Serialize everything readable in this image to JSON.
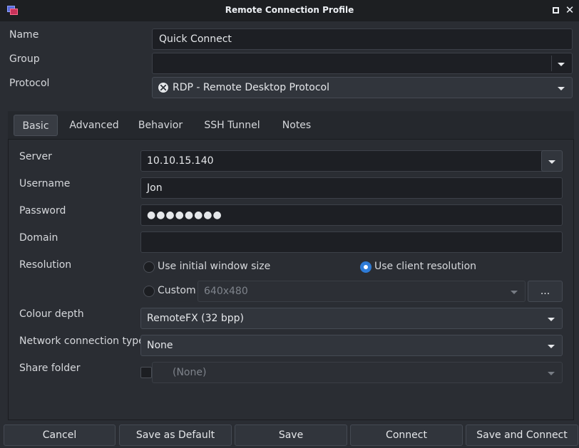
{
  "window": {
    "title": "Remote Connection Profile"
  },
  "profile": {
    "name_label": "Name",
    "name_value": "Quick Connect",
    "group_label": "Group",
    "group_value": "",
    "protocol_label": "Protocol",
    "protocol_value": "RDP - Remote Desktop Protocol",
    "protocol_icon": "rdp-icon"
  },
  "tabs": [
    {
      "label": "Basic",
      "active": true
    },
    {
      "label": "Advanced"
    },
    {
      "label": "Behavior"
    },
    {
      "label": "SSH Tunnel"
    },
    {
      "label": "Notes"
    }
  ],
  "basic": {
    "server_label": "Server",
    "server_value": "10.10.15.140",
    "username_label": "Username",
    "username_value": "Jon",
    "password_label": "Password",
    "password_value": "●●●●●●●●",
    "domain_label": "Domain",
    "domain_value": "",
    "resolution_label": "Resolution",
    "resolution_options": {
      "initial": "Use initial window size",
      "client": "Use client resolution",
      "custom": "Custom"
    },
    "resolution_selected": "client",
    "custom_resolution_value": "640x480",
    "custom_button": "...",
    "colour_depth_label": "Colour depth",
    "colour_depth_value": "RemoteFX (32 bpp)",
    "network_label": "Network connection type",
    "network_value": "None",
    "share_folder_label": "Share folder",
    "share_folder_checked": false,
    "share_folder_value": "(None)"
  },
  "buttons": {
    "cancel": "Cancel",
    "save_default": "Save as Default",
    "save": "Save",
    "connect": "Connect",
    "save_connect": "Save and Connect"
  },
  "colors": {
    "accent": "#2e7bd6",
    "background": "#2a2d33",
    "titlebar": "#1d1f22"
  }
}
